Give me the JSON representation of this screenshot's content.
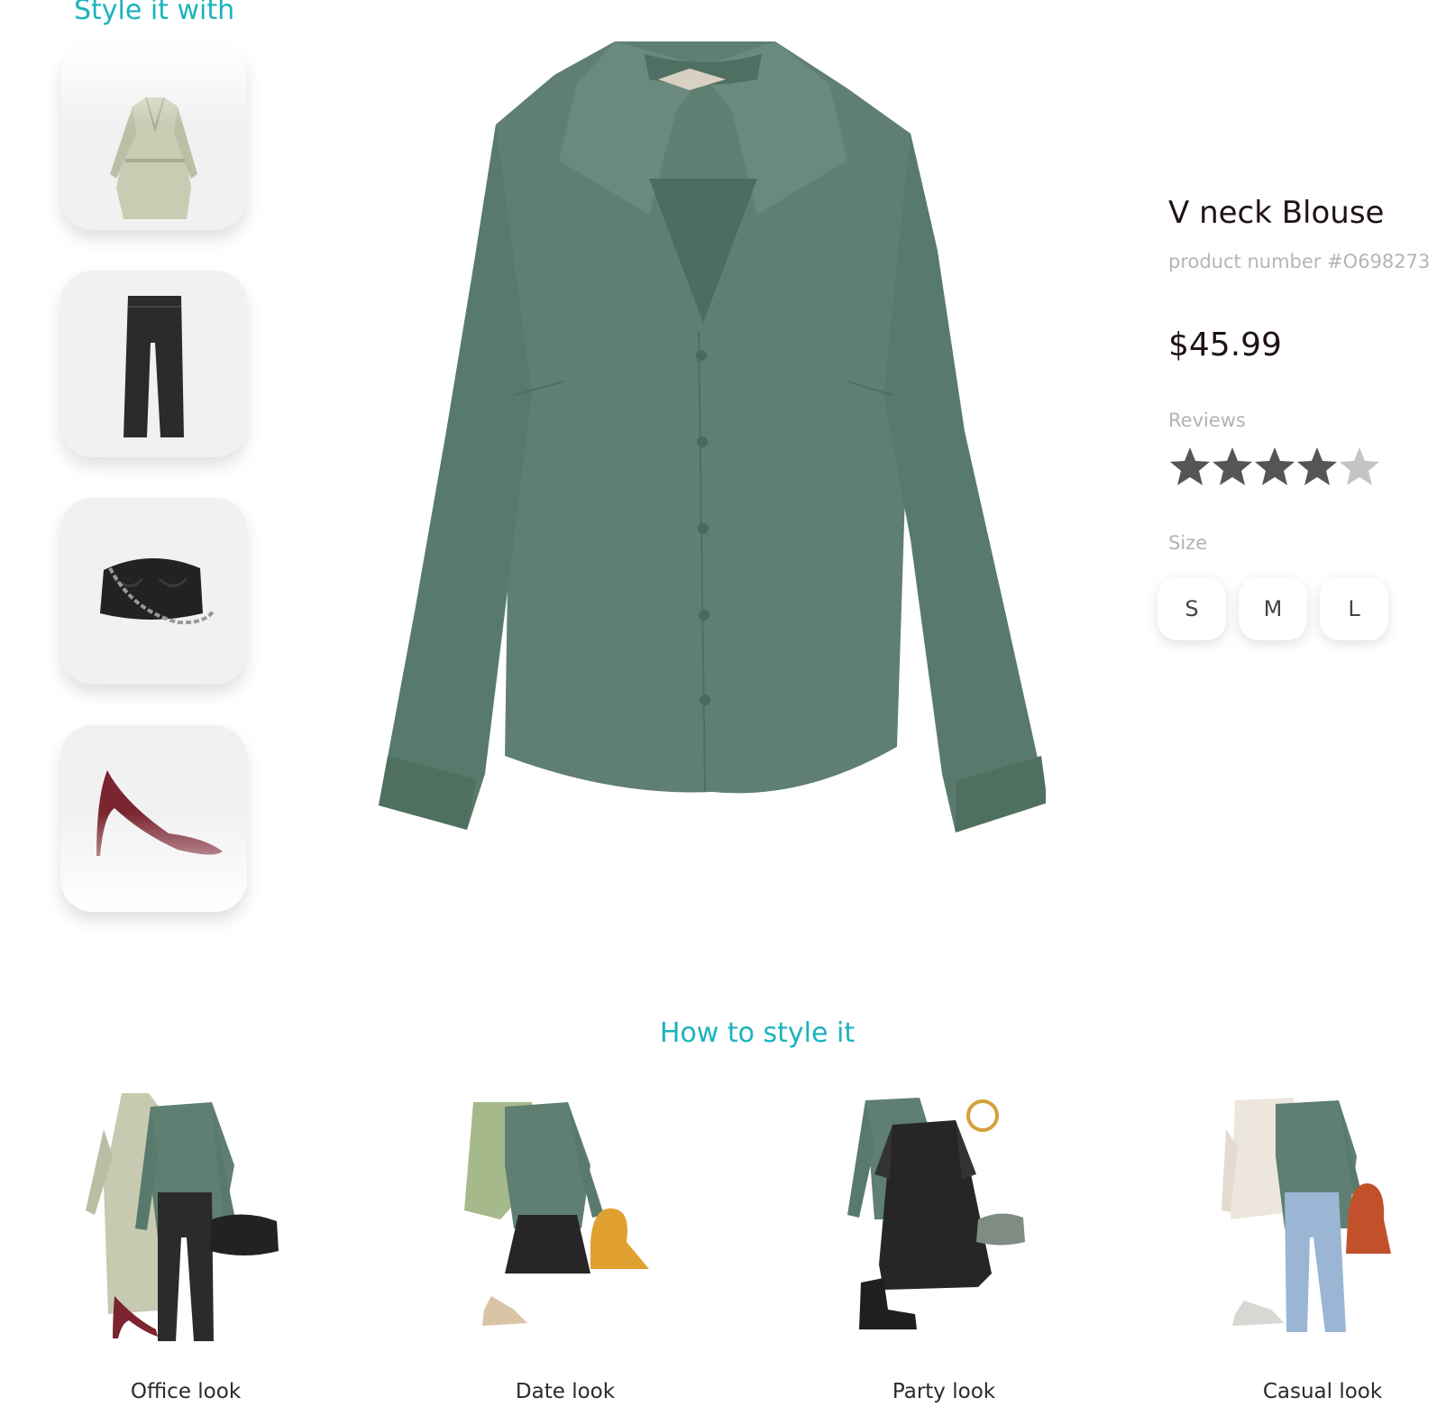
{
  "style_with": {
    "title": "Style it with",
    "items": [
      {
        "icon": "trench-coat-icon"
      },
      {
        "icon": "black-jeans-icon"
      },
      {
        "icon": "black-clutch-bag-icon"
      },
      {
        "icon": "burgundy-pump-shoe-icon"
      }
    ]
  },
  "product": {
    "image_icon": "green-satin-blouse",
    "title": "V neck Blouse",
    "number": "product number #O698273",
    "price": "$45.99",
    "reviews_label": "Reviews",
    "rating": 4,
    "rating_max": 5,
    "size_label": "Size",
    "sizes": [
      "S",
      "M",
      "L"
    ]
  },
  "how_to": {
    "title": "How to style it",
    "looks": [
      {
        "label": "Office look"
      },
      {
        "label": "Date look"
      },
      {
        "label": "Party look"
      },
      {
        "label": "Casual look"
      }
    ]
  },
  "colors": {
    "accent": "#1bb3bd",
    "blouse": "#5e7f72",
    "text_dark": "#1f1216",
    "muted": "#b3b3b3",
    "star_filled": "#555555",
    "star_empty": "#c4c4c4"
  }
}
